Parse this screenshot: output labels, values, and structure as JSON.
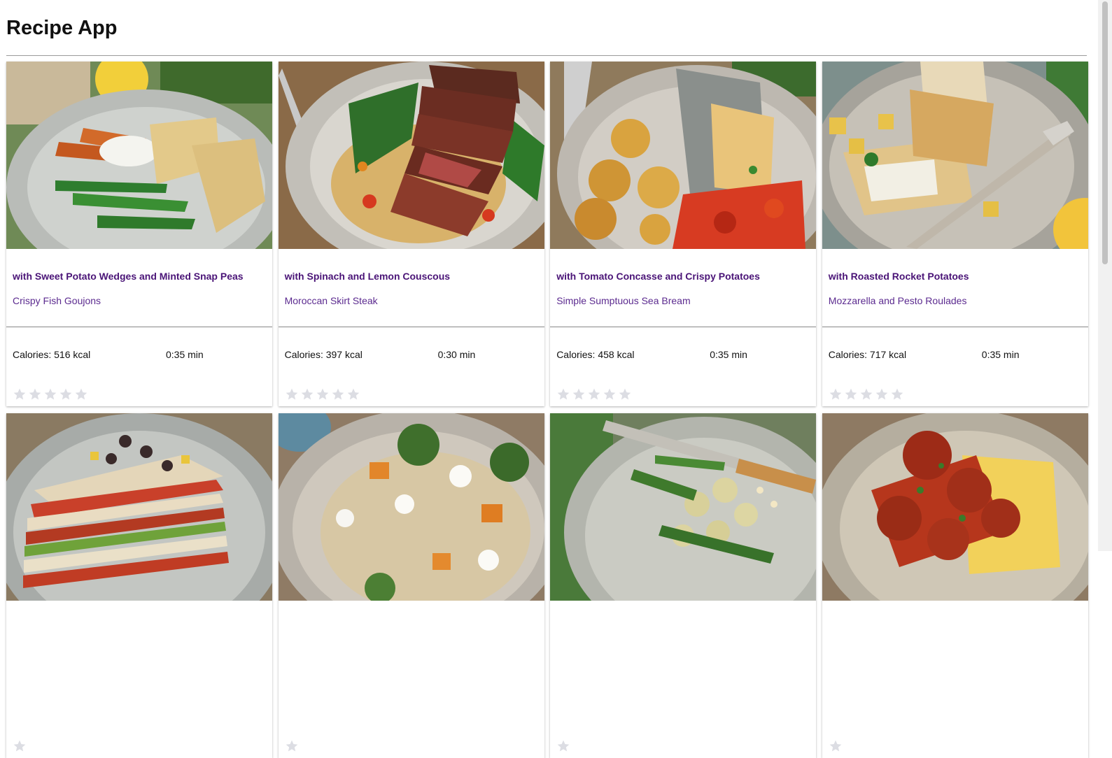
{
  "app": {
    "title": "Recipe App"
  },
  "recipes": [
    {
      "subtitle": "with Sweet Potato Wedges and Minted Snap Peas",
      "name": "Crispy Fish Goujons",
      "calories": "Calories: 516 kcal",
      "time": "0:35 min",
      "rating": 0
    },
    {
      "subtitle": "with Spinach and Lemon Couscous",
      "name": "Moroccan Skirt Steak",
      "calories": "Calories: 397 kcal",
      "time": "0:30 min",
      "rating": 0
    },
    {
      "subtitle": "with Tomato Concasse and Crispy Potatoes",
      "name": "Simple Sumptuous Sea Bream",
      "calories": "Calories: 458 kcal",
      "time": "0:35 min",
      "rating": 0
    },
    {
      "subtitle": "with Roasted Rocket Potatoes",
      "name": "Mozzarella and Pesto Roulades",
      "calories": "Calories: 717 kcal",
      "time": "0:35 min",
      "rating": 0
    },
    {
      "rating": 0
    },
    {
      "rating": 0
    },
    {
      "rating": 0
    },
    {
      "rating": 0
    }
  ],
  "colors": {
    "title_text": "#111111",
    "subtitle_text": "#4a1477",
    "name_text": "#5b2a8f",
    "star_empty": "#dcdde3"
  },
  "icons": {
    "star": "star-icon"
  }
}
